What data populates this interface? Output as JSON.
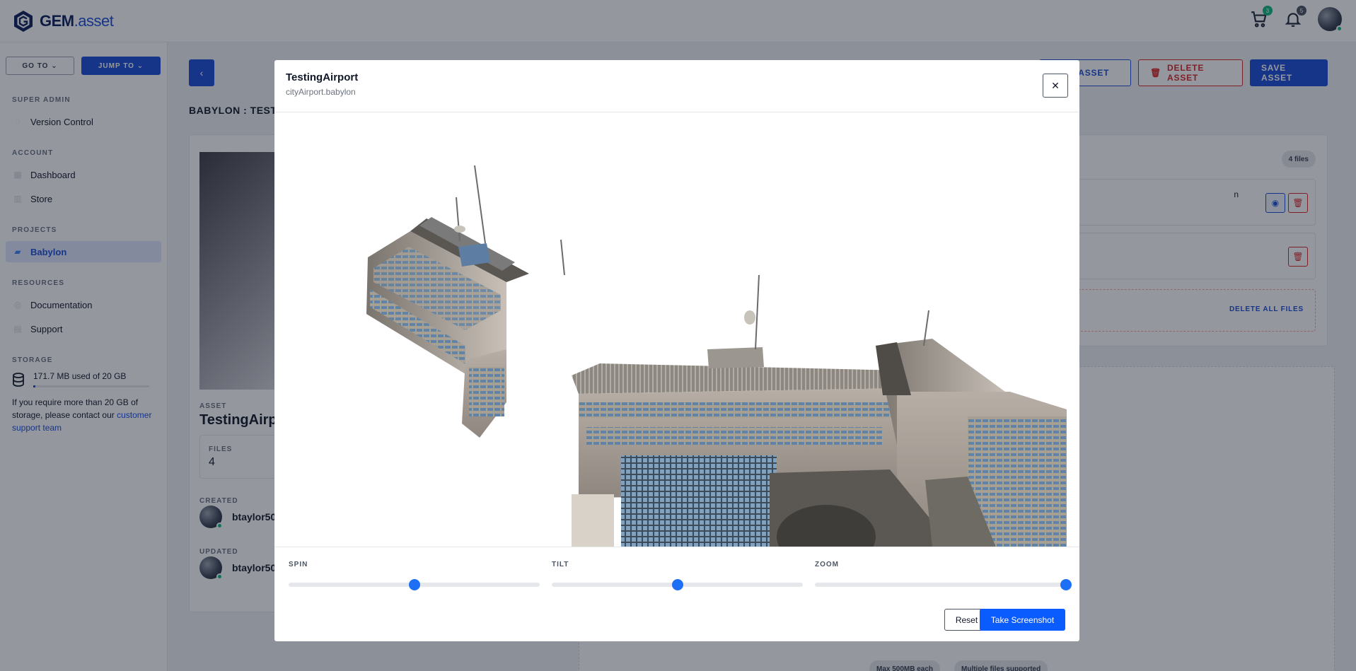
{
  "brand": {
    "name": "GEM",
    "suffix": ".asset"
  },
  "header": {
    "cart_count": "3",
    "notification_count": "5"
  },
  "sidebar": {
    "goto_label": "GO TO",
    "jump_label": "JUMP TO",
    "sections": [
      {
        "heading": "SUPER ADMIN",
        "items": [
          {
            "label": "Version Control"
          }
        ]
      },
      {
        "heading": "ACCOUNT",
        "items": [
          {
            "label": "Dashboard"
          },
          {
            "label": "Store"
          }
        ]
      },
      {
        "heading": "PROJECTS",
        "items": [
          {
            "label": "Babylon"
          }
        ]
      },
      {
        "heading": "RESOURCES",
        "items": [
          {
            "label": "Documentation"
          },
          {
            "label": "Support"
          }
        ]
      }
    ],
    "storage": {
      "heading": "STORAGE",
      "usage": "171.7 MB used of 20 GB",
      "used_fraction": 0.0084,
      "note": "If you require more than 20 GB of storage, please contact our",
      "link": "customer support team"
    }
  },
  "page": {
    "breadcrumb": "BABYLON : TESTI",
    "buttons": {
      "new_asset": "EW ASSET",
      "delete_asset": "DELETE ASSET",
      "save_asset": "SAVE ASSET"
    },
    "asset_label": "ASSET",
    "asset_name": "TestingAirpo",
    "files_label": "FILES",
    "files_value": "4",
    "created_label": "CREATED",
    "created_user": "btaylor50",
    "updated_label": "UPDATED",
    "updated_user": "btaylor50",
    "files_count": "4 files",
    "file_row_name": "n",
    "delete_all": "DELETE ALL FILES",
    "pill_max": "Max 500MB each",
    "pill_multi": "Multiple files supported"
  },
  "modal": {
    "title": "TestingAirport",
    "subtitle": "cityAirport.babylon",
    "close_icon": "close-icon",
    "sliders": [
      {
        "label": "SPIN",
        "value": 0.5
      },
      {
        "label": "TILT",
        "value": 0.5
      },
      {
        "label": "ZOOM",
        "value": 1.0
      }
    ],
    "reset_label": "Reset",
    "screenshot_label": "Take Screenshot"
  }
}
